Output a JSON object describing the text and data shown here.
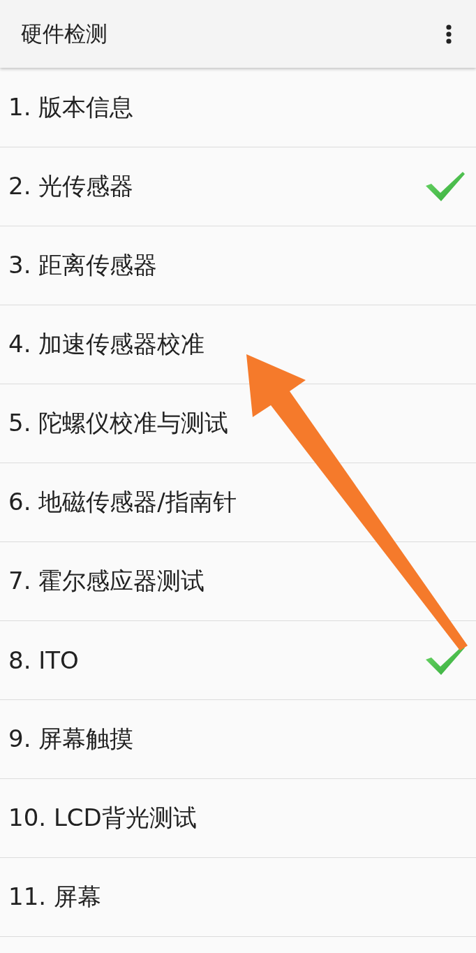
{
  "app_bar": {
    "title": "硬件检测"
  },
  "items": [
    {
      "label": "1. 版本信息",
      "checked": false
    },
    {
      "label": "2. 光传感器",
      "checked": true
    },
    {
      "label": "3. 距离传感器",
      "checked": false
    },
    {
      "label": "4. 加速传感器校准",
      "checked": false
    },
    {
      "label": "5. 陀螺仪校准与测试",
      "checked": false
    },
    {
      "label": "6. 地磁传感器/指南针",
      "checked": false
    },
    {
      "label": "7. 霍尔感应器测试",
      "checked": false
    },
    {
      "label": "8. ITO",
      "checked": true
    },
    {
      "label": "9. 屏幕触摸",
      "checked": false
    },
    {
      "label": "10. LCD背光测试",
      "checked": false
    },
    {
      "label": "11. 屏幕",
      "checked": false
    }
  ]
}
